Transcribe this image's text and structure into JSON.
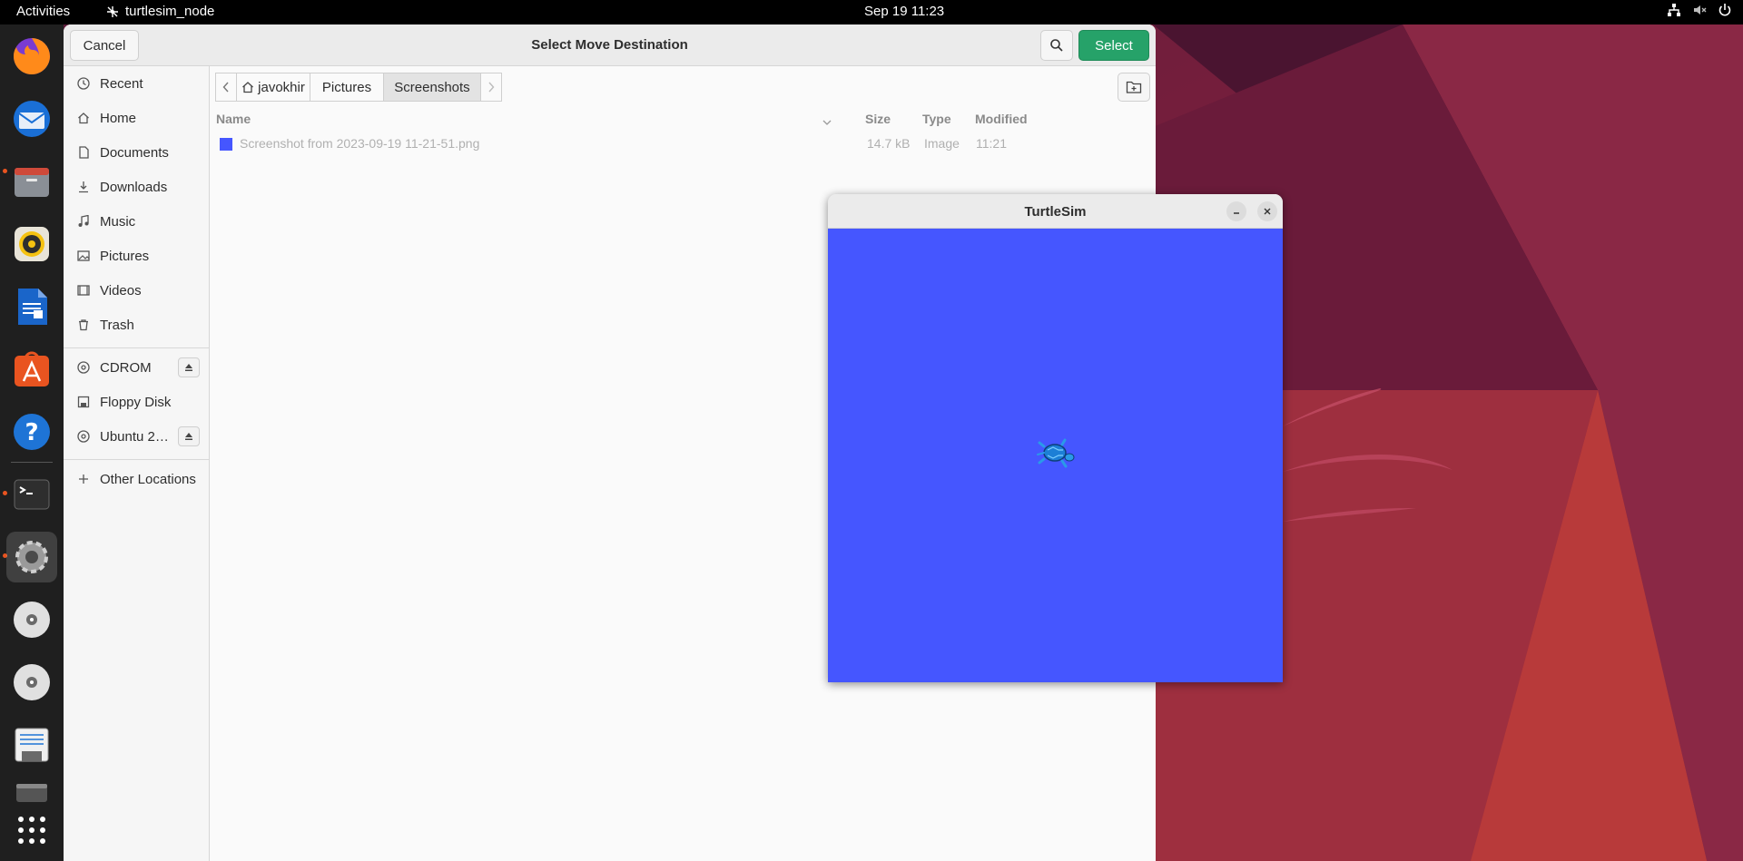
{
  "topbar": {
    "activities": "Activities",
    "app_name": "turtlesim_node",
    "clock": "Sep 19  11:23",
    "tray_icons": [
      "network-icon",
      "volume-muted-icon",
      "power-icon"
    ]
  },
  "dock": {
    "items": [
      "firefox",
      "thunderbird",
      "files",
      "rhythmbox",
      "libreoffice-writer",
      "app-center",
      "help",
      "terminal",
      "settings",
      "cdrom",
      "dvd",
      "floppy",
      "drive",
      "show-apps"
    ]
  },
  "dialog": {
    "title": "Select Move Destination",
    "cancel_label": "Cancel",
    "select_label": "Select",
    "accent_color": "#26a269"
  },
  "sidebar": {
    "places": [
      {
        "label": "Recent",
        "icon": "clock-icon"
      },
      {
        "label": "Home",
        "icon": "home-icon"
      },
      {
        "label": "Documents",
        "icon": "document-icon"
      },
      {
        "label": "Downloads",
        "icon": "download-icon"
      },
      {
        "label": "Music",
        "icon": "music-icon"
      },
      {
        "label": "Pictures",
        "icon": "picture-icon"
      },
      {
        "label": "Videos",
        "icon": "video-icon"
      },
      {
        "label": "Trash",
        "icon": "trash-icon"
      }
    ],
    "devices": [
      {
        "label": "CDROM",
        "icon": "disc-icon"
      },
      {
        "label": "Floppy Disk",
        "icon": "floppy-icon"
      },
      {
        "label": "Ubuntu 2…",
        "icon": "disc-icon"
      }
    ],
    "other": {
      "label": "Other Locations",
      "icon": "plus-icon"
    }
  },
  "pathbar": {
    "crumbs": [
      "javokhir",
      "Pictures",
      "Screenshots"
    ]
  },
  "filelist": {
    "columns": {
      "name": "Name",
      "size": "Size",
      "type": "Type",
      "modified": "Modified"
    },
    "rows": [
      {
        "name": "Screenshot from 2023-09-19 11-21-51.png",
        "size": "14.7 kB",
        "type": "Image",
        "modified": "11:21"
      }
    ]
  },
  "turtlesim": {
    "title": "TurtleSim",
    "background_color": "#4556ff"
  }
}
